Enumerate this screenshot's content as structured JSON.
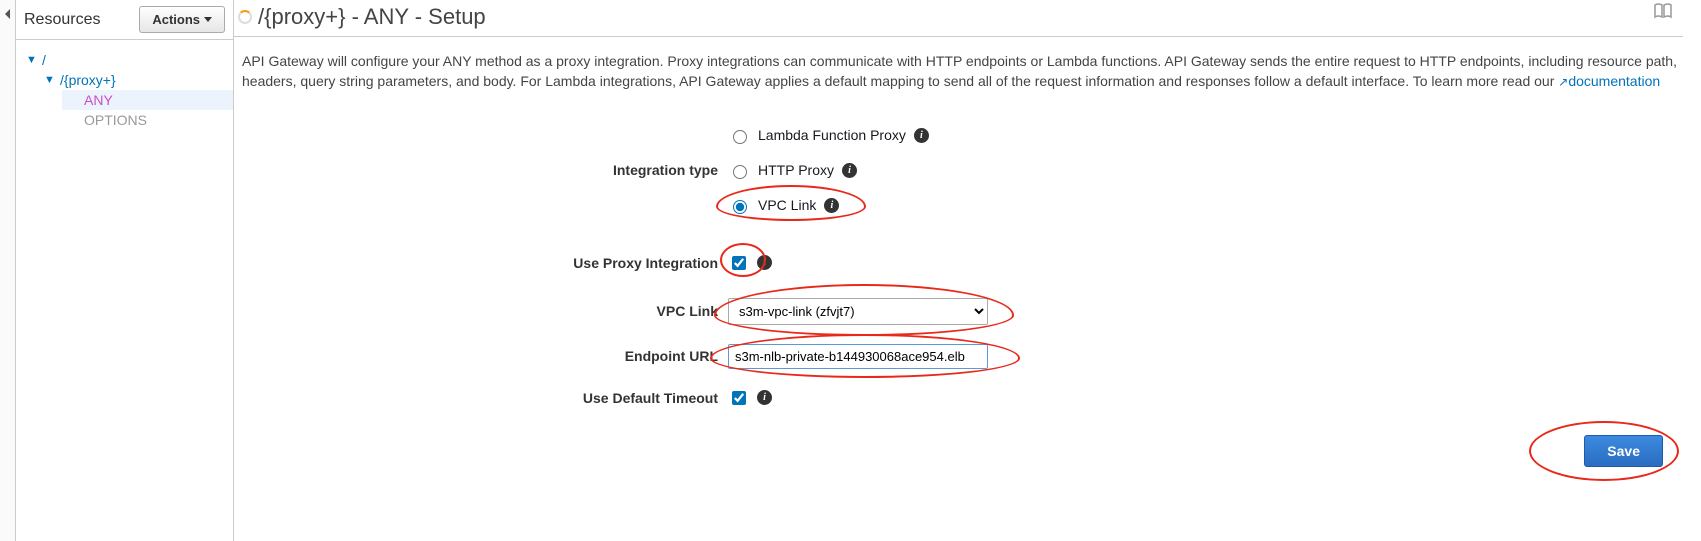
{
  "sidebar": {
    "title": "Resources",
    "actions_label": "Actions",
    "tree": {
      "root": "/",
      "proxy": "/{proxy+}",
      "methods": [
        "ANY",
        "OPTIONS"
      ],
      "selected": "ANY"
    }
  },
  "page": {
    "title": "/{proxy+} - ANY - Setup",
    "description_1": "API Gateway will configure your ANY method as a proxy integration. Proxy integrations can communicate with HTTP endpoints or Lambda functions. API Gateway sends the entire request to HTTP endpoints, including resource path, headers, query string parameters, and body. For Lambda integrations, API Gateway applies a default mapping to send all of the request information and responses follow a default interface. To learn more read our ",
    "doc_link_label": "documentation"
  },
  "form": {
    "integration_type_label": "Integration type",
    "integration_options": {
      "lambda": "Lambda Function Proxy",
      "http": "HTTP Proxy",
      "vpc": "VPC Link"
    },
    "integration_selected": "vpc",
    "use_proxy_label": "Use Proxy Integration",
    "use_proxy_checked": true,
    "vpc_link_label": "VPC Link",
    "vpc_link_value": "s3m-vpc-link (zfvjt7)",
    "endpoint_url_label": "Endpoint URL",
    "endpoint_url_value": "s3m-nlb-private-b144930068ace954.elb",
    "use_default_timeout_label": "Use Default Timeout",
    "use_default_timeout_checked": true,
    "save_label": "Save"
  }
}
